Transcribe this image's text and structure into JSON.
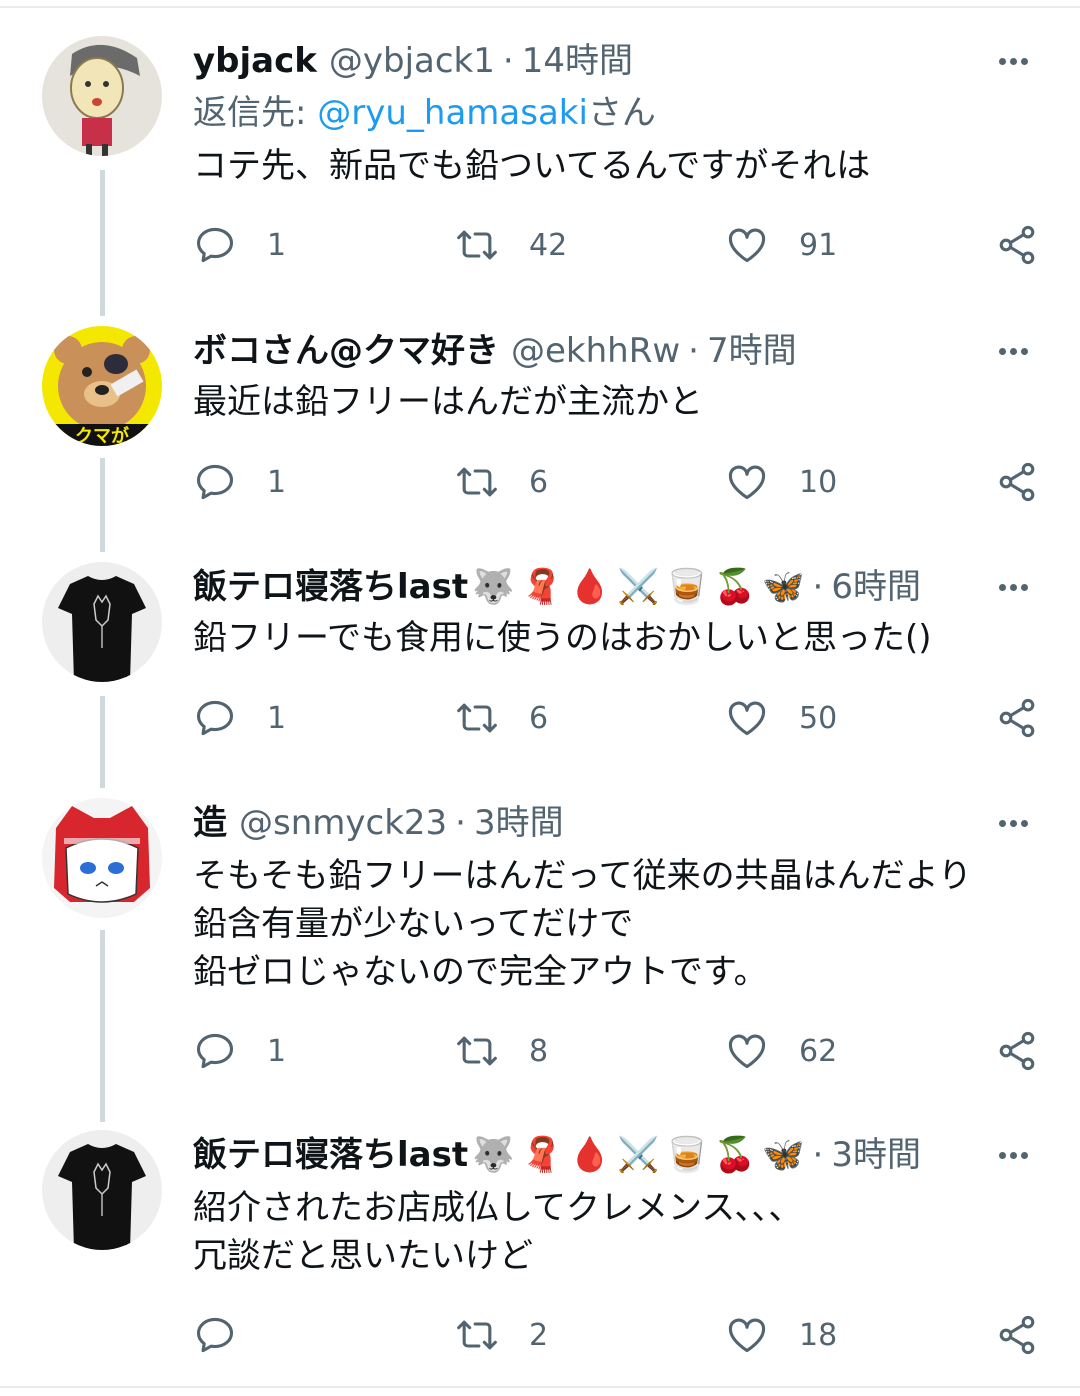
{
  "tweets": [
    {
      "name": "ybjack",
      "handle": "@ybjack1",
      "time": "14時間",
      "dot": "·",
      "reply_prefix": "返信先: ",
      "reply_mention": "@ryu_hamasaki",
      "reply_suffix": "さん",
      "text": "コテ先、新品でも鉛ついてるんですがそれは",
      "replies": "1",
      "retweets": "42",
      "likes": "91"
    },
    {
      "name": "ボコさん@クマ好き",
      "handle": "@ekhhRw",
      "time": "7時間",
      "dot": "·",
      "text": "最近は鉛フリーはんだが主流かと",
      "replies": "1",
      "retweets": "6",
      "likes": "10",
      "avatar_text": "クマが"
    },
    {
      "name": "飯テロ寝落ちlast",
      "name_emoji": [
        "🐺",
        "🧣",
        "🩸",
        "⚔️",
        "🥃",
        "🍒",
        "🦋"
      ],
      "time": "6時間",
      "dot": "·",
      "text": "鉛フリーでも食用に使うのはおかしいと思った()",
      "replies": "1",
      "retweets": "6",
      "likes": "50"
    },
    {
      "name": "造",
      "handle": "@snmyck23",
      "time": "3時間",
      "dot": "·",
      "text": "そもそも鉛フリーはんだって従来の共晶はんだより\n鉛含有量が少ないってだけで\n鉛ゼロじゃないので完全アウトです。",
      "replies": "1",
      "retweets": "8",
      "likes": "62"
    },
    {
      "name": "飯テロ寝落ちlast",
      "name_emoji": [
        "🐺",
        "🧣",
        "🩸",
        "⚔️",
        "🥃",
        "🍒",
        "🦋"
      ],
      "time": "3時間",
      "dot": "·",
      "text": "紹介されたお店成仏してクレメンス､､､\n冗談だと思いたいけど",
      "replies": "",
      "retweets": "2",
      "likes": "18"
    }
  ],
  "colors": {
    "secondary": "#536471",
    "link": "#1d9bf0",
    "thread_line": "#cfd9de"
  }
}
